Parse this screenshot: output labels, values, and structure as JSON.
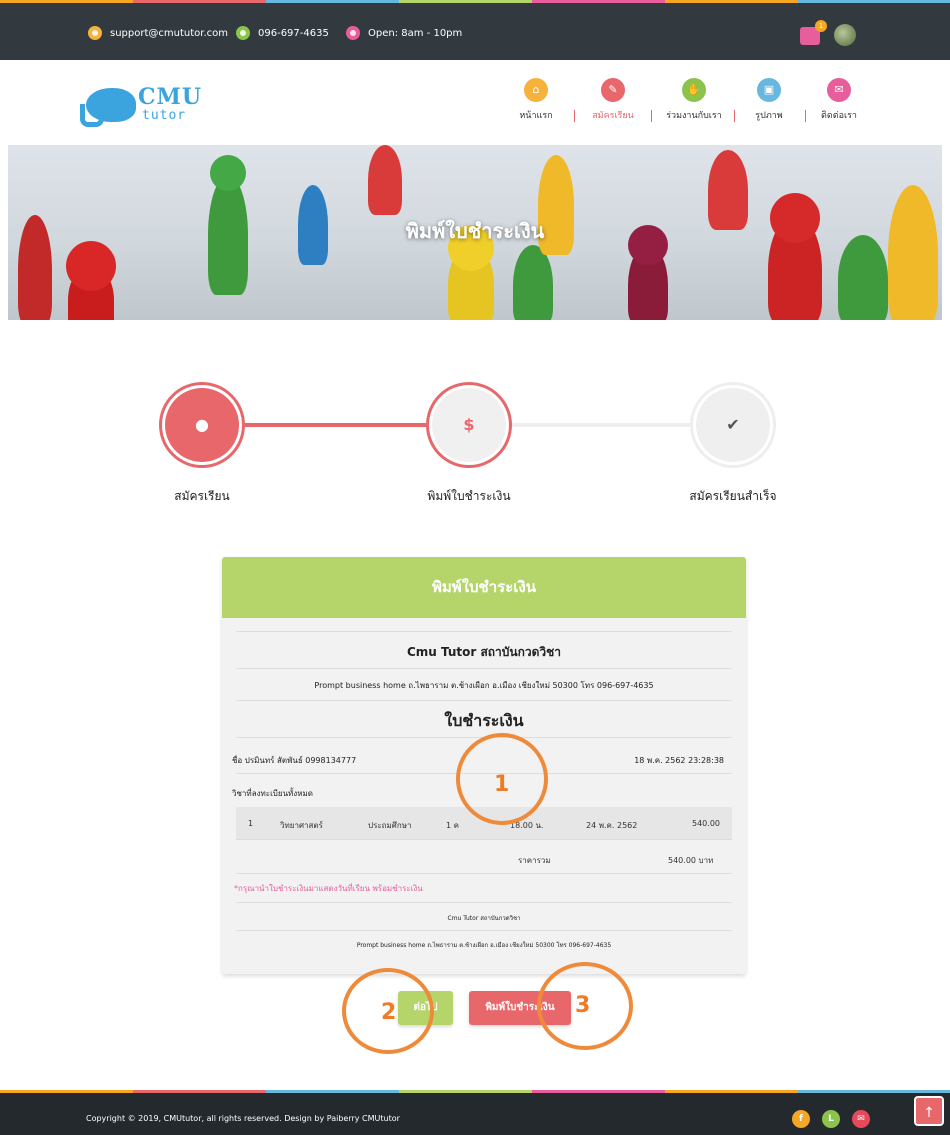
{
  "topbar": {
    "email": "support@cmututor.com",
    "phone": "096-697-4635",
    "hours": "Open: 8am - 10pm",
    "cart_count": "1"
  },
  "logo": {
    "cmu": "CMU",
    "tutor": "tutor"
  },
  "nav": [
    {
      "label": "หน้าแรก",
      "icon": "home-icon",
      "color": "#f5b23d"
    },
    {
      "label": "สมัครเรียน",
      "icon": "pencil-icon",
      "color": "#e8676a"
    },
    {
      "label": "ร่วมงานกับเรา",
      "icon": "handshake-icon",
      "color": "#8cc34b"
    },
    {
      "label": "รูปภาพ",
      "icon": "image-icon",
      "color": "#67b7df"
    },
    {
      "label": "ติดต่อเรา",
      "icon": "mail-icon",
      "color": "#e85d9c"
    }
  ],
  "hero": {
    "title": "พิมพ์ใบชำระเงิน"
  },
  "steps": [
    {
      "label": "สมัครเรียน",
      "icon": "user-icon",
      "glyph": "👤"
    },
    {
      "label": "พิมพ์ใบชำระเงิน",
      "icon": "dollar-icon",
      "glyph": "$"
    },
    {
      "label": "สมัครเรียนสำเร็จ",
      "icon": "check-icon",
      "glyph": "✔"
    }
  ],
  "receipt": {
    "header": "พิมพ์ใบชำระเงิน",
    "institute": "Cmu Tutor สถาบันกวดวิชา",
    "address": "Prompt business home ถ.ไพธาราม ต.ช้างเผือก อ.เมือง เชียงใหม่ 50300 โทร 096-697-4635",
    "doc_title": "ใบชำระเงิน",
    "name_line": "ชื่อ ปรมินทร์ สัตพันธ์ 0998134777",
    "datetime": "18 พ.ค. 2562 23:28:38",
    "subjects_label": "วิชาที่ลงทะเบียนทั้งหมด",
    "row": {
      "no": "1",
      "subject": "วิทยาศาสตร์",
      "level": "ประถมศึกษา",
      "hours": "1 ค",
      "time": "18.00 น.",
      "date": "24 พ.ค. 2562",
      "price": "540.00"
    },
    "total_label": "ราคารวม",
    "total_value": "540.00 บาท",
    "note": "*กรุณานำใบชำระเงินมาแสดงวันที่เรียน พร้อมชำระเงิน",
    "footer_institute": "Cmu Tutor สถาบันกวดวิชา",
    "footer_address": "Prompt business home ถ.ไพธาราม ต.ช้างเผือก อ.เมือง เชียงใหม่ 50300 โทร 096-697-4635"
  },
  "buttons": {
    "next": "ต่อไป",
    "print": "พิมพ์ใบชำระเงิน"
  },
  "annotations": [
    "1",
    "2",
    "3"
  ],
  "footer": {
    "copyright": "Copyright © 2019, CMUtutor, all rights reserved. Design by Paiberry CMUtutor",
    "social": [
      {
        "icon": "facebook-icon",
        "glyph": "f",
        "color": "#f5a623"
      },
      {
        "icon": "line-icon",
        "glyph": "L",
        "color": "#8cc34b"
      },
      {
        "icon": "mail-icon",
        "glyph": "✉",
        "color": "#e8495a"
      }
    ],
    "to_top": "↑"
  },
  "colors": {
    "green": "#b5d56a",
    "red": "#e8676a",
    "orange_annotation": "#ee8a3a"
  }
}
